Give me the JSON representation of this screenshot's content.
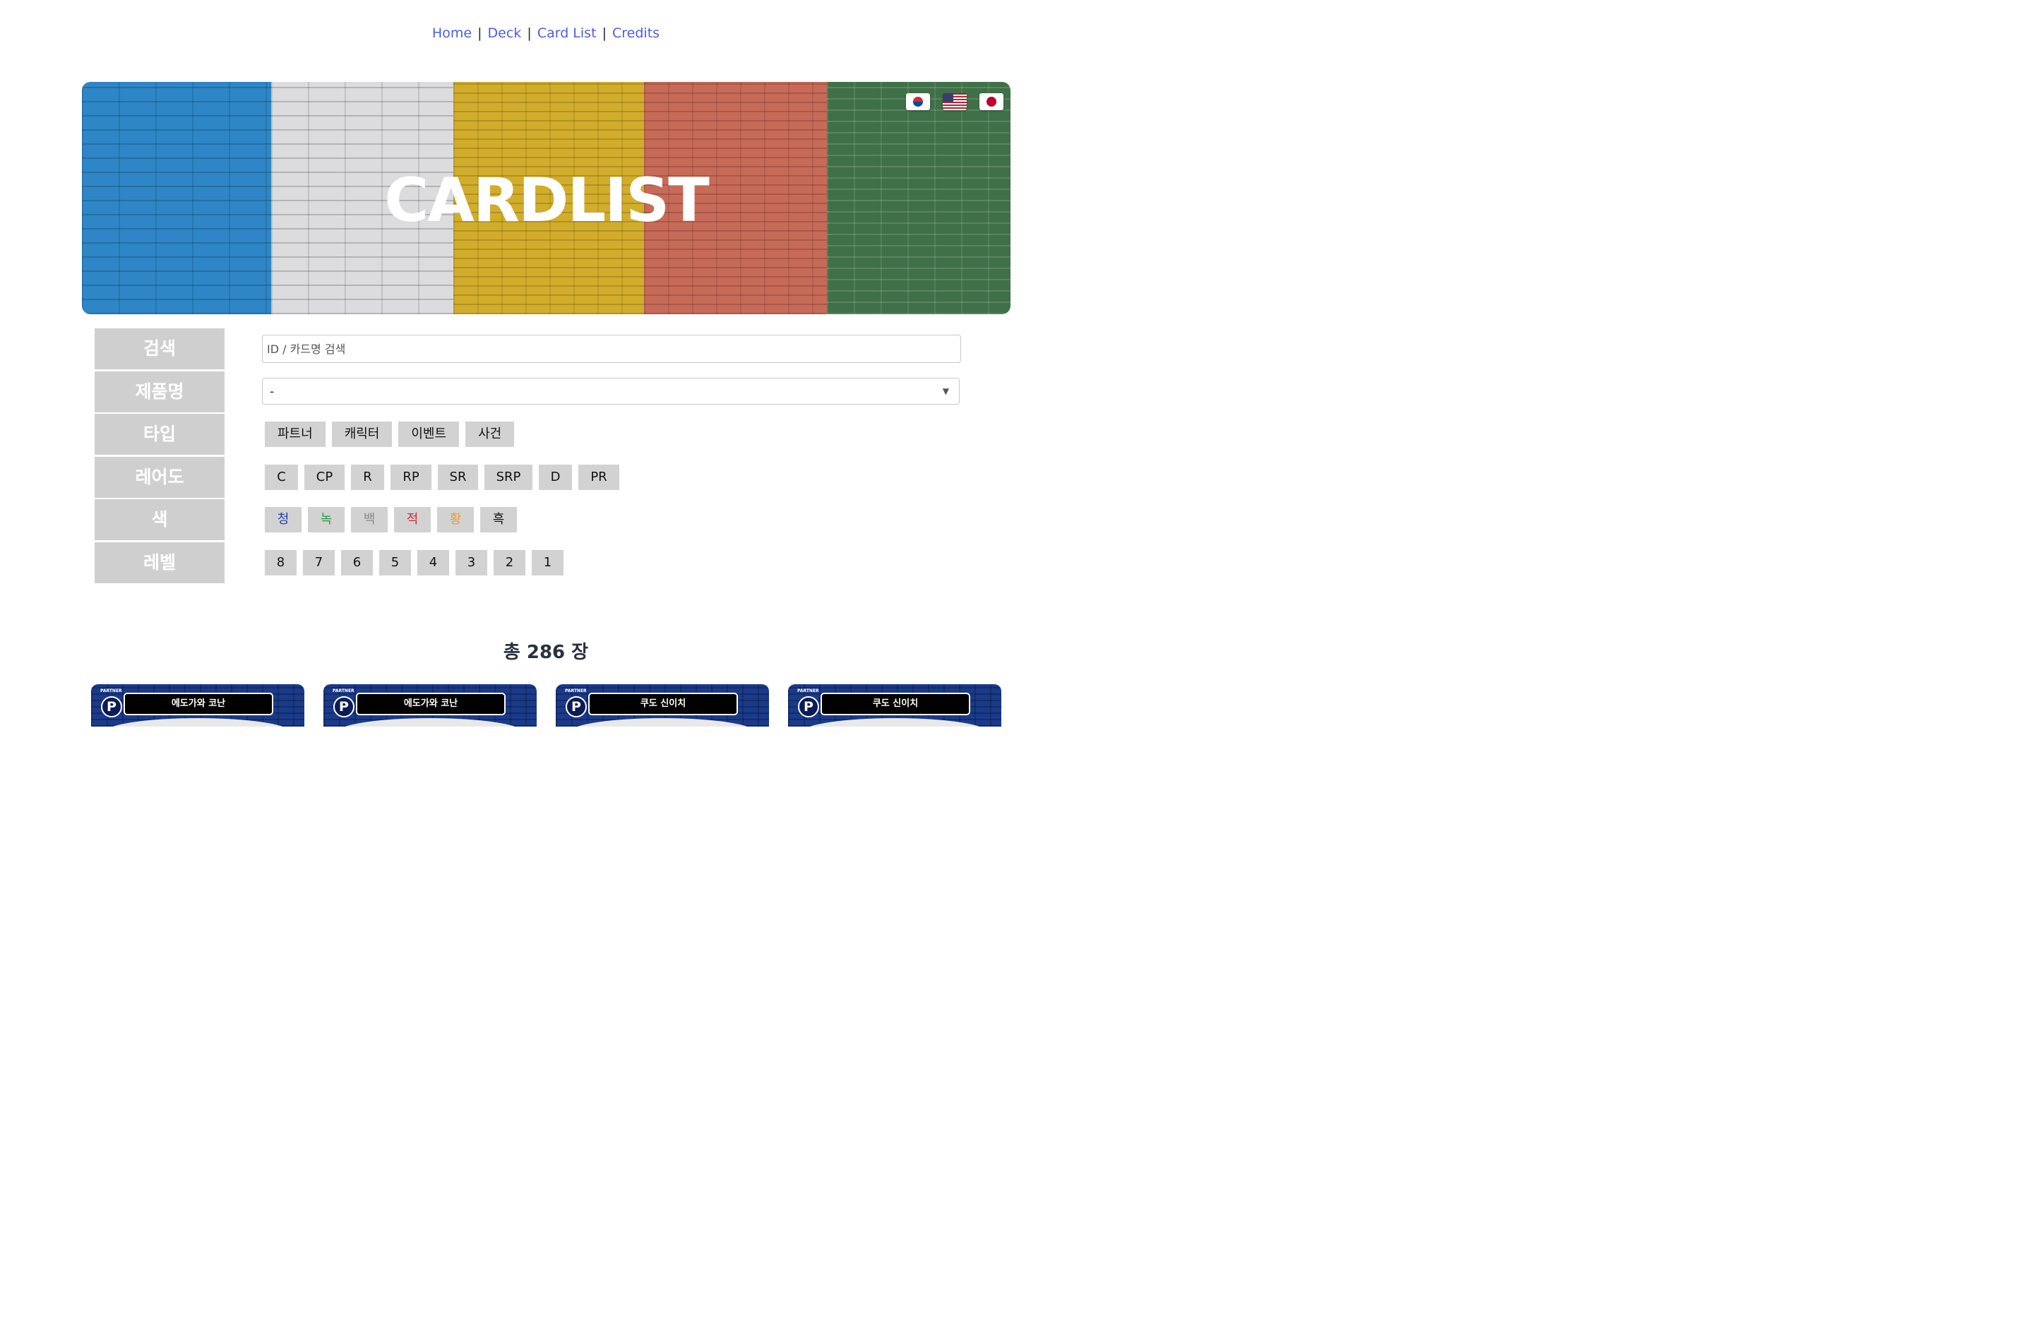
{
  "nav": {
    "links": [
      "Home",
      "Deck",
      "Card List",
      "Credits"
    ],
    "separator": "|"
  },
  "banner": {
    "title": "CARDLIST",
    "stripe_colors": [
      "#2e86c6",
      "#dcdcde",
      "#d2ad2b",
      "#c76a58",
      "#3f7047"
    ],
    "languages": [
      "korea-flag-icon",
      "usa-flag-icon",
      "japan-flag-icon"
    ]
  },
  "filters": {
    "search": {
      "label": "검색",
      "placeholder": "ID / 카드명 검색",
      "value": ""
    },
    "product": {
      "label": "제품명",
      "selected": "-"
    },
    "type": {
      "label": "타입",
      "options": [
        "파트너",
        "캐릭터",
        "이벤트",
        "사건"
      ]
    },
    "rarity": {
      "label": "레어도",
      "options": [
        "C",
        "CP",
        "R",
        "RP",
        "SR",
        "SRP",
        "D",
        "PR"
      ]
    },
    "color": {
      "label": "색",
      "options": [
        {
          "text": "청",
          "color": "#1f3ca8"
        },
        {
          "text": "녹",
          "color": "#2a9a3a"
        },
        {
          "text": "백",
          "color": "#8a8a8a"
        },
        {
          "text": "적",
          "color": "#d0283a"
        },
        {
          "text": "황",
          "color": "#e0a030"
        },
        {
          "text": "흑",
          "color": "#111111"
        }
      ]
    },
    "level": {
      "label": "레벨",
      "options": [
        "8",
        "7",
        "6",
        "5",
        "4",
        "3",
        "2",
        "1"
      ]
    }
  },
  "results": {
    "total_text": "총 286 장",
    "cards": [
      {
        "badge": "P",
        "tag": "PARTNER",
        "name": "에도가와 코난"
      },
      {
        "badge": "P",
        "tag": "PARTNER",
        "name": "에도가와 코난"
      },
      {
        "badge": "P",
        "tag": "PARTNER",
        "name": "쿠도 신이치"
      },
      {
        "badge": "P",
        "tag": "PARTNER",
        "name": "쿠도 신이치"
      }
    ]
  }
}
